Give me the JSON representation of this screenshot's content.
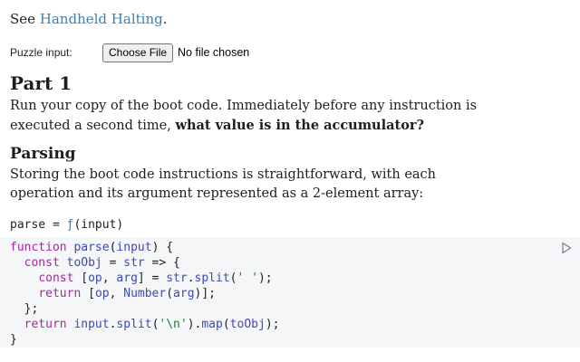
{
  "see": {
    "prefix": "See ",
    "link": "Handheld Halting",
    "suffix": "."
  },
  "puzzle": {
    "label": "Puzzle input:",
    "button": "Choose File",
    "status": "No file chosen"
  },
  "part1": {
    "title": "Part 1",
    "text_before": "Run your copy of the boot code. Immediately before any instruction is executed a second time, ",
    "text_bold": "what value is in the accumulator?"
  },
  "parsing": {
    "title": "Parsing",
    "text": "Storing the boot code instructions is straightforward, with each operation and its argument represented as a 2-element array:"
  },
  "cell": {
    "name": "parse",
    "eq": " = ",
    "f": "ƒ",
    "args": "(input)"
  },
  "code": {
    "l1": [
      "function",
      " ",
      "parse",
      "(",
      "input",
      ") {"
    ],
    "l2": [
      "  ",
      "const",
      " ",
      "toObj",
      " = ",
      "str",
      " => {"
    ],
    "l3": [
      "    ",
      "const",
      " [",
      "op",
      ", ",
      "arg",
      "] = ",
      "str",
      ".",
      "split",
      "(",
      "' '",
      ");"
    ],
    "l4": [
      "    ",
      "return",
      " [",
      "op",
      ", ",
      "Number",
      "(",
      "arg",
      ")];"
    ],
    "l5": [
      "  };"
    ],
    "l6": [
      "  ",
      "return",
      " ",
      "input",
      ".",
      "split",
      "(",
      "'\\n'",
      ").",
      "map",
      "(",
      "toObj",
      ");"
    ],
    "l7": [
      "}"
    ]
  }
}
